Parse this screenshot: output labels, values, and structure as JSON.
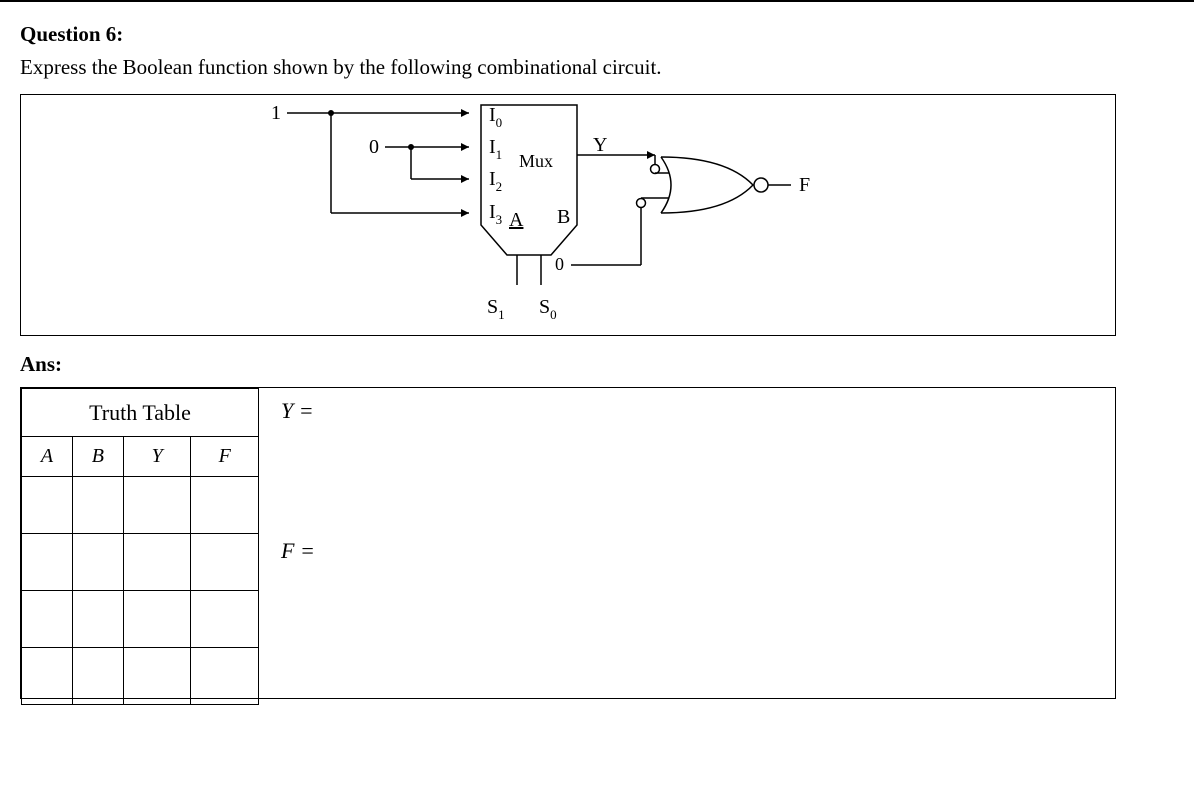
{
  "question": {
    "title": "Question 6:",
    "prompt": "Express the Boolean function shown by the following combinational circuit."
  },
  "circuit": {
    "const_1": "1",
    "const_0": "0",
    "const_B0": "0",
    "mux_label": "Mux",
    "inputs": {
      "I0": "I",
      "I1": "I",
      "I2": "I",
      "I3": "I"
    },
    "input_sub": {
      "I0": "0",
      "I1": "1",
      "I2": "2",
      "I3": "3"
    },
    "A": "A",
    "B": "B",
    "Y": "Y",
    "S1": "S",
    "S1_sub": "1",
    "S0": "S",
    "S0_sub": "0",
    "F": "F"
  },
  "answer": {
    "label": "Ans:",
    "truth_table_title": "Truth Table",
    "cols": {
      "A": "A",
      "B": "B",
      "Y": "Y",
      "F": "F"
    },
    "Y_eq_label": "Y =",
    "F_eq_label": "F ="
  }
}
